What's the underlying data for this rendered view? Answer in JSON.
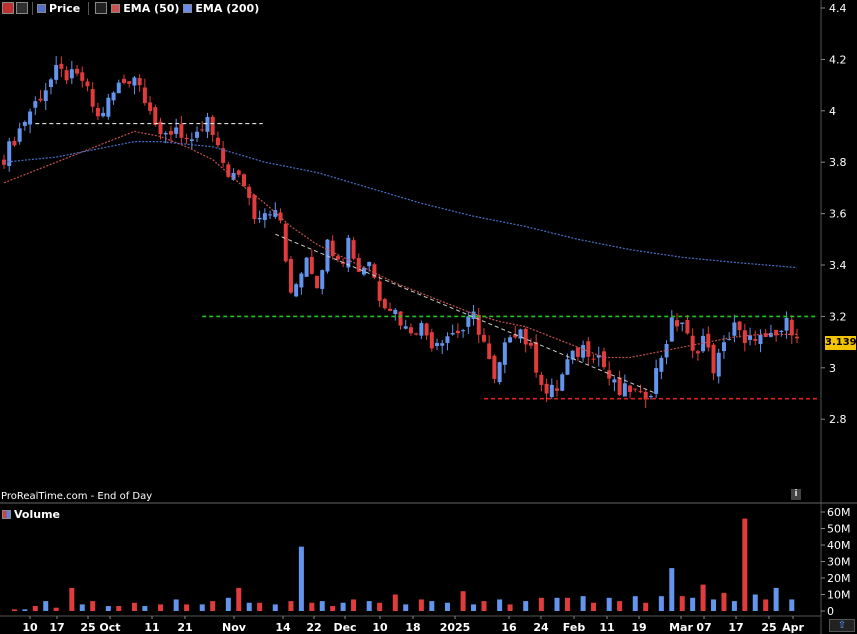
{
  "header": {
    "price_label": "Price",
    "ema50_label": "EMA (50)",
    "ema200_label": "EMA (200)",
    "colors": {
      "up": "#6495ed",
      "down": "#e03c3c",
      "ema50": "#c05050",
      "ema200": "#4a6ec8",
      "price_tag": "#f5c400"
    }
  },
  "footer": {
    "source": "ProRealTime.com - End of Day"
  },
  "volume_panel": {
    "label": "Volume"
  },
  "last_price_tag": "3.139",
  "chart_data": [
    {
      "type": "candlestick",
      "title": "",
      "y_ticks": [
        "4.4",
        "4.2",
        "4",
        "3.8",
        "3.6",
        "3.4",
        "3.2",
        "3",
        "2.8"
      ],
      "ylim": [
        2.62,
        4.44
      ],
      "x_tick_labels": [
        "10",
        "17",
        "25",
        "Oct",
        "11",
        "21",
        "Nov",
        "14",
        "22",
        "Dec",
        "10",
        "18",
        "2025",
        "16",
        "24",
        "Feb",
        "11",
        "19",
        "Mar",
        "07",
        "17",
        "25",
        "Apr"
      ],
      "last_price": 3.139,
      "series": [
        {
          "name": "Price",
          "style": "candles"
        },
        {
          "name": "EMA (50)",
          "style": "dotted-line"
        },
        {
          "name": "EMA (200)",
          "style": "dotted-line"
        }
      ],
      "price_path": [
        [
          0,
          3.82
        ],
        [
          5,
          4.0
        ],
        [
          10,
          4.15
        ],
        [
          15,
          4.12
        ],
        [
          18,
          3.97
        ],
        [
          22,
          4.1
        ],
        [
          25,
          4.14
        ],
        [
          28,
          4.02
        ],
        [
          30,
          3.88
        ],
        [
          33,
          3.94
        ],
        [
          36,
          3.86
        ],
        [
          39,
          3.96
        ],
        [
          41,
          3.84
        ],
        [
          43,
          3.76
        ],
        [
          46,
          3.72
        ],
        [
          48,
          3.6
        ],
        [
          51,
          3.62
        ],
        [
          53,
          3.57
        ],
        [
          55,
          3.27
        ],
        [
          58,
          3.44
        ],
        [
          60,
          3.33
        ],
        [
          62,
          3.48
        ],
        [
          65,
          3.43
        ],
        [
          66,
          3.5
        ],
        [
          68,
          3.38
        ],
        [
          70,
          3.42
        ],
        [
          72,
          3.28
        ],
        [
          75,
          3.22
        ],
        [
          77,
          3.15
        ],
        [
          80,
          3.16
        ],
        [
          82,
          3.1
        ],
        [
          85,
          3.13
        ],
        [
          88,
          3.15
        ],
        [
          90,
          3.2
        ],
        [
          92,
          3.1
        ],
        [
          94,
          2.94
        ],
        [
          97,
          3.14
        ],
        [
          99,
          3.15
        ],
        [
          101,
          3.06
        ],
        [
          104,
          2.9
        ],
        [
          106,
          2.92
        ],
        [
          108,
          3.02
        ],
        [
          111,
          3.08
        ],
        [
          114,
          3.05
        ],
        [
          116,
          2.96
        ],
        [
          118,
          2.9
        ],
        [
          120,
          2.92
        ],
        [
          122,
          2.88
        ],
        [
          124,
          2.92
        ],
        [
          126,
          3.05
        ],
        [
          128,
          3.17
        ],
        [
          130,
          3.18
        ],
        [
          132,
          3.05
        ],
        [
          134,
          3.12
        ],
        [
          136,
          3.0
        ],
        [
          138,
          3.08
        ],
        [
          140,
          3.18
        ],
        [
          142,
          3.08
        ],
        [
          144,
          3.13
        ],
        [
          146,
          3.1
        ],
        [
          148,
          3.12
        ],
        [
          150,
          3.17
        ],
        [
          152,
          3.14
        ]
      ],
      "ema50_path": [
        [
          0,
          3.72
        ],
        [
          10,
          3.8
        ],
        [
          20,
          3.88
        ],
        [
          25,
          3.92
        ],
        [
          30,
          3.9
        ],
        [
          35,
          3.86
        ],
        [
          40,
          3.81
        ],
        [
          45,
          3.72
        ],
        [
          50,
          3.64
        ],
        [
          55,
          3.55
        ],
        [
          60,
          3.48
        ],
        [
          65,
          3.43
        ],
        [
          70,
          3.38
        ],
        [
          75,
          3.33
        ],
        [
          80,
          3.29
        ],
        [
          85,
          3.25
        ],
        [
          90,
          3.21
        ],
        [
          95,
          3.18
        ],
        [
          100,
          3.16
        ],
        [
          105,
          3.12
        ],
        [
          110,
          3.08
        ],
        [
          115,
          3.04
        ],
        [
          120,
          3.04
        ],
        [
          125,
          3.06
        ],
        [
          130,
          3.08
        ],
        [
          135,
          3.1
        ],
        [
          140,
          3.12
        ],
        [
          145,
          3.13
        ],
        [
          152,
          3.13
        ]
      ],
      "ema200_path": [
        [
          0,
          3.8
        ],
        [
          10,
          3.82
        ],
        [
          20,
          3.86
        ],
        [
          25,
          3.88
        ],
        [
          30,
          3.88
        ],
        [
          40,
          3.86
        ],
        [
          50,
          3.8
        ],
        [
          60,
          3.76
        ],
        [
          70,
          3.7
        ],
        [
          80,
          3.64
        ],
        [
          90,
          3.59
        ],
        [
          100,
          3.55
        ],
        [
          110,
          3.5
        ],
        [
          120,
          3.46
        ],
        [
          130,
          3.43
        ],
        [
          140,
          3.41
        ],
        [
          152,
          3.39
        ]
      ],
      "annotations": [
        {
          "type": "horizontal-dashed",
          "color": "#ffffff",
          "y": 3.95,
          "from": 6,
          "to": 45
        },
        {
          "type": "horizontal-dashed",
          "color": "#22c322",
          "y": 3.2,
          "from": 38,
          "to": 152
        },
        {
          "type": "horizontal-dashed",
          "color": "#e02020",
          "y": 2.88,
          "from": 92,
          "to": 152
        },
        {
          "type": "trendline-dashed",
          "color": "#cccccc",
          "from": [
            52,
            3.52
          ],
          "to": [
            125,
            2.9
          ]
        }
      ]
    },
    {
      "type": "bar",
      "title": "Volume",
      "y_ticks": [
        "60M",
        "50M",
        "40M",
        "30M",
        "20M",
        "10M",
        "0"
      ],
      "ylim": [
        0,
        62
      ],
      "bars": [
        [
          2,
          1,
          "d"
        ],
        [
          4,
          1,
          "u"
        ],
        [
          6,
          3,
          "d"
        ],
        [
          8,
          6,
          "u"
        ],
        [
          10,
          2,
          "d"
        ],
        [
          13,
          14,
          "d"
        ],
        [
          15,
          4,
          "u"
        ],
        [
          17,
          6,
          "d"
        ],
        [
          20,
          3,
          "u"
        ],
        [
          22,
          3,
          "d"
        ],
        [
          25,
          5,
          "d"
        ],
        [
          27,
          3,
          "u"
        ],
        [
          30,
          4,
          "d"
        ],
        [
          33,
          7,
          "u"
        ],
        [
          35,
          4,
          "d"
        ],
        [
          38,
          4,
          "u"
        ],
        [
          40,
          6,
          "d"
        ],
        [
          43,
          8,
          "u"
        ],
        [
          45,
          14,
          "d"
        ],
        [
          47,
          5,
          "u"
        ],
        [
          49,
          5,
          "d"
        ],
        [
          52,
          4,
          "u"
        ],
        [
          55,
          6,
          "d"
        ],
        [
          57,
          39,
          "u"
        ],
        [
          59,
          5,
          "d"
        ],
        [
          61,
          6,
          "u"
        ],
        [
          63,
          3,
          "d"
        ],
        [
          65,
          5,
          "u"
        ],
        [
          67,
          7,
          "d"
        ],
        [
          70,
          6,
          "u"
        ],
        [
          72,
          5,
          "d"
        ],
        [
          75,
          10,
          "d"
        ],
        [
          77,
          4,
          "u"
        ],
        [
          80,
          7,
          "d"
        ],
        [
          82,
          6,
          "u"
        ],
        [
          85,
          5,
          "u"
        ],
        [
          88,
          12,
          "d"
        ],
        [
          90,
          4,
          "u"
        ],
        [
          92,
          6,
          "d"
        ],
        [
          95,
          7,
          "u"
        ],
        [
          97,
          4,
          "d"
        ],
        [
          100,
          6,
          "u"
        ],
        [
          103,
          8,
          "d"
        ],
        [
          106,
          8,
          "u"
        ],
        [
          108,
          8,
          "d"
        ],
        [
          111,
          9,
          "u"
        ],
        [
          113,
          5,
          "d"
        ],
        [
          116,
          8,
          "u"
        ],
        [
          118,
          6,
          "d"
        ],
        [
          121,
          9,
          "u"
        ],
        [
          123,
          5,
          "d"
        ],
        [
          126,
          9,
          "u"
        ],
        [
          128,
          26,
          "u"
        ],
        [
          130,
          9,
          "d"
        ],
        [
          132,
          8,
          "u"
        ],
        [
          134,
          16,
          "d"
        ],
        [
          136,
          7,
          "u"
        ],
        [
          138,
          11,
          "d"
        ],
        [
          140,
          6,
          "u"
        ],
        [
          142,
          56,
          "d"
        ],
        [
          144,
          10,
          "u"
        ],
        [
          146,
          7,
          "d"
        ],
        [
          148,
          14,
          "u"
        ],
        [
          151,
          7,
          "u"
        ]
      ]
    }
  ]
}
